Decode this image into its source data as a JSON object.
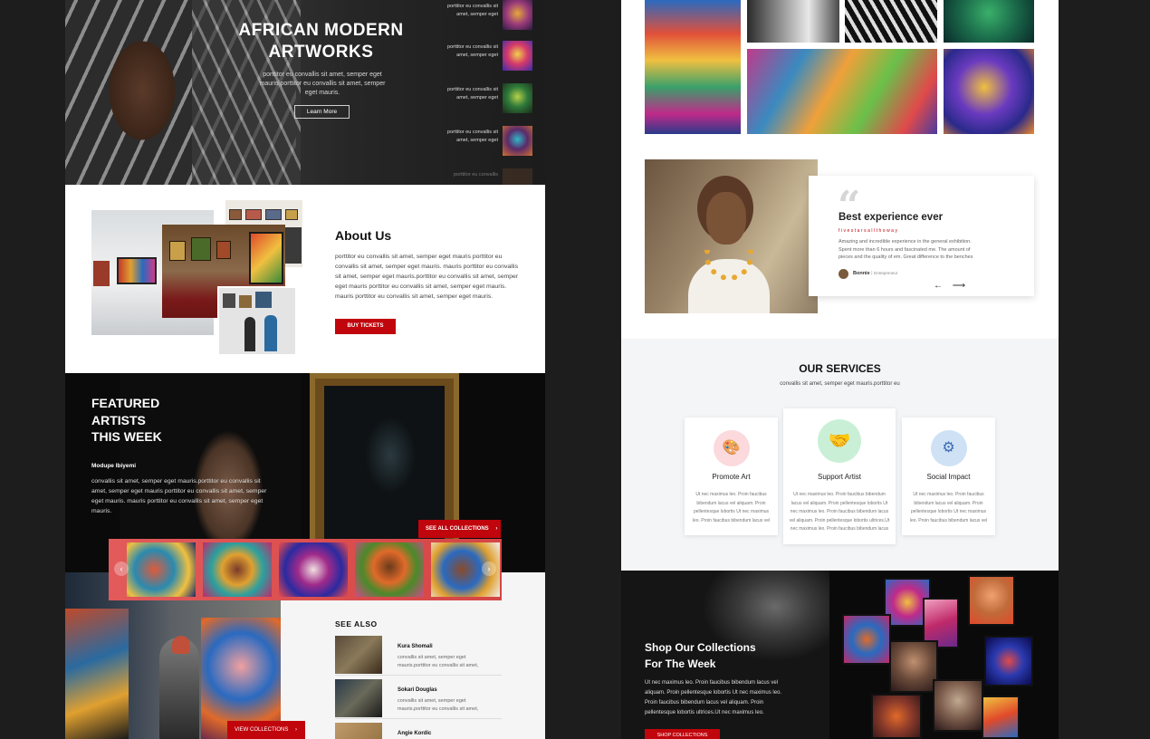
{
  "hero": {
    "title_line1": "AFRICAN MODERN",
    "title_line2": "ARTWORKS",
    "subtitle": "porttitor eu convallis sit amet, semper eget mauris porttitor eu convallis sit amet, semper eget mauris.",
    "cta_label": "Learn More",
    "side_cards": [
      {
        "text": "porttitor eu convallis sit amet, semper eget"
      },
      {
        "text": "porttitor eu convallis sit amet, semper eget"
      },
      {
        "text": "porttitor eu convallis sit amet, semper eget"
      },
      {
        "text": "porttitor eu convallis sit amet, semper eget"
      },
      {
        "text": "porttitor eu convallis"
      }
    ]
  },
  "about": {
    "title": "About Us",
    "body": "porttitor eu convallis sit amet, semper eget mauris porttitor eu convallis sit amet, semper eget mauris. mauris porttitor eu convallis sit amet, semper eget mauris.porttitor eu convallis sit amet, semper eget mauris porttitor eu convallis sit amet, semper eget mauris. mauris porttitor eu convallis sit amet, semper eget mauris.",
    "cta_label": "BUY TICKETS"
  },
  "featured": {
    "title_line1": "FEATURED",
    "title_line2": "ARTISTS",
    "title_line3": "THIS WEEK",
    "artist_name": "Modupe Ibiyemi",
    "body": "convallis sit amet, semper eget mauris.porttitor eu convallis sit amet, semper eget mauris porttitor eu convallis sit amet, semper eget mauris. mauris porttitor eu convallis sit amet, semper eget mauris.",
    "see_all_label": "SEE ALL COLLECTIONS",
    "prev_icon": "‹",
    "next_icon": "›"
  },
  "see_also": {
    "title": "SEE  ALSO",
    "items": [
      {
        "name": "Kura Shomali",
        "desc": "convallis sit amet, semper eget mauris.porttitor eu convallis sit amet,"
      },
      {
        "name": "Sokari Douglas",
        "desc": "convallis sit amet, semper eget mauris.porttitor eu convallis sit amet,"
      },
      {
        "name": "Angie Kordic",
        "desc": ""
      }
    ],
    "view_label": "VIEW COLLECTIONS"
  },
  "testimonial": {
    "quote_mark": "“",
    "title": "Best experience ever",
    "subtitle": "fivestarsallthoway",
    "body": "Amazing and incredible experience in the general exhibition. Spent more than 6 hours and fascinated me. The amount of pieces and the quality of em. Great difference to the benches",
    "name": "Bonnie",
    "role": "Entrepreneur",
    "arrows": "← ⟶"
  },
  "services": {
    "title": "OUR SERVICES",
    "subtitle": "convallis sit amet, semper eget mauris.porttitor eu",
    "items": [
      {
        "title": "Promote Art",
        "icon": "palette-icon",
        "glyph": "🎨",
        "color": "#fbd9dc",
        "desc": "Ut nec maximus leo. Proin faucibus bibendum lacus vel aliquam. Proin pellentesque lobortis Ut nec maximus leo. Proin faucibus bibendum lacus vel"
      },
      {
        "title": "Support Artist",
        "icon": "handshake-icon",
        "glyph": "🤝",
        "color": "#c9f0d6",
        "desc": "Ut nec maximus leo. Proin faucibus bibendum lacus vel aliquam. Proin pellentesque lobortis Ut nec maximus leo. Proin faucibus bibendum lacus vel aliquam. Proin pellentesque lobortis ultrices.Ut nec maximus leo. Proin faucibus bibendum lacus"
      },
      {
        "title": "Social Impact",
        "icon": "network-icon",
        "glyph": "⚙",
        "color": "#cfe1f5",
        "desc": "Ut nec maximus leo. Proin faucibus bibendum lacus vel aliquam. Proin pellentesque lobortis Ut nec maximus leo. Proin faucibus bibendum lacus vel"
      }
    ]
  },
  "shop": {
    "title_line1": "Shop Our Collections",
    "title_line2": "For The Week",
    "body": "Ut nec maximus leo. Proin faucibus bibendum lacus vel aliquam. Proin pellentesque lobortis Ut nec maximus leo. Proin faucibus bibendum lacus vel aliquam. Proin pellentesque lobortis ultrices.Ut nec maximus leo.",
    "cta_label": "SHOP COLLECTIONS"
  },
  "colors": {
    "accent": "#c0050d",
    "dark": "#0a0a0a",
    "light_bg": "#f4f5f7"
  }
}
